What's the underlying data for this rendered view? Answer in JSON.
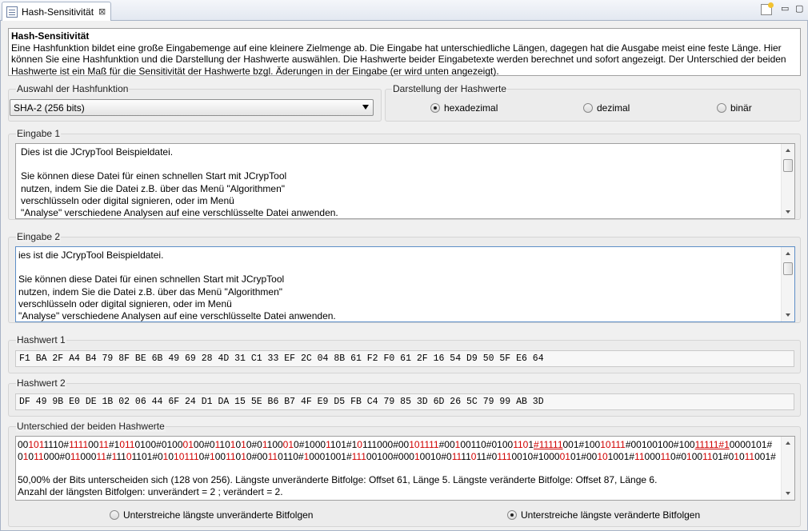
{
  "tab": {
    "title": "Hash-Sensitivität",
    "close": "⊠"
  },
  "view_controls": {
    "minimize": "▭",
    "maximize": "▢"
  },
  "description": {
    "title": "Hash-Sensitivität",
    "text": "Eine Hashfunktion bildet eine große Eingabemenge auf eine kleinere Zielmenge ab. Die Eingabe hat unterschiedliche Längen, dagegen hat die Ausgabe meist eine feste Länge. Hier können Sie eine Hashfunktion und die Darstellung der Hashwerte auswählen. Die Hashwerte beider Eingabetexte werden berechnet und sofort angezeigt. Der Unterschied der beiden Hashwerte ist ein Maß für die Sensitivität der Hashwerte bzgl. Äderungen in der Eingabe (er wird unten angezeigt)."
  },
  "hash_function": {
    "legend": "Auswahl der Hashfunktion",
    "selected": "SHA-2 (256 bits)"
  },
  "representation": {
    "legend": "Darstellung der Hashwerte",
    "options": [
      {
        "label": "hexadezimal",
        "selected": true
      },
      {
        "label": "dezimal",
        "selected": false
      },
      {
        "label": "binär",
        "selected": false
      }
    ]
  },
  "input1": {
    "legend": "Eingabe 1",
    "text": "Dies ist die JCrypTool Beispieldatei.\n\nSie können diese Datei für einen schnellen Start mit JCrypTool\nnutzen, indem Sie die Datei z.B. über das Menü \"Algorithmen\"\nverschlüsseln oder digital signieren, oder im Menü\n\"Analyse\" verschiedene Analysen auf eine verschlüsselte Datei anwenden."
  },
  "input2": {
    "legend": "Eingabe 2",
    "text": "ies ist die JCrypTool Beispieldatei.\n\nSie können diese Datei für einen schnellen Start mit JCrypTool\nnutzen, indem Sie die Datei z.B. über das Menü \"Algorithmen\"\nverschlüsseln oder digital signieren, oder im Menü\n\"Analyse\" verschiedene Analysen auf eine verschlüsselte Datei anwenden."
  },
  "hash1": {
    "legend": "Hashwert 1",
    "value": "F1 BA 2F A4 B4 79 8F BE 6B 49 69 28 4D 31 C1 33 EF 2C 04 8B 61 F2 F0 61 2F 16 54 D9 50 5F E6 64"
  },
  "hash2": {
    "legend": "Hashwert 2",
    "value": "DF 49 9B E0 DE 1B 02 06 44 6F 24 D1 DA 15 5E B6 B7 4F E9 D5 FB C4 79 85 3D 6D 26 5C 79 99 AB 3D"
  },
  "difference": {
    "legend": "Unterschied der beiden Hashwerte",
    "colors": {
      "changed": "#d00000"
    },
    "line1_segments": [
      {
        "t": "00"
      },
      {
        "t": "101",
        "c": 1
      },
      {
        "t": "1110#"
      },
      {
        "t": "1111",
        "c": 1
      },
      {
        "t": "00"
      },
      {
        "t": "11",
        "c": 1
      },
      {
        "t": "#1"
      },
      {
        "t": "011",
        "c": 1
      },
      {
        "t": "0100#0100"
      },
      {
        "t": "01",
        "c": 1
      },
      {
        "t": "00#0"
      },
      {
        "t": "1",
        "c": 1
      },
      {
        "t": "10"
      },
      {
        "t": "1",
        "c": 1
      },
      {
        "t": "0"
      },
      {
        "t": "1",
        "c": 1
      },
      {
        "t": "0#0"
      },
      {
        "t": "1",
        "c": 1
      },
      {
        "t": "100"
      },
      {
        "t": "01",
        "c": 1
      },
      {
        "t": "0#1000"
      },
      {
        "t": "1",
        "c": 1
      },
      {
        "t": "101#1"
      },
      {
        "t": "0",
        "c": 1
      },
      {
        "t": "111000#00"
      },
      {
        "t": "101111",
        "c": 1
      },
      {
        "t": "#00"
      },
      {
        "t": "1",
        "c": 1
      },
      {
        "t": "00110#0100"
      },
      {
        "t": "110",
        "c": 1
      },
      {
        "t": "1"
      },
      {
        "t": "#11111",
        "c": 1,
        "u": 1
      },
      {
        "t": "001#100"
      },
      {
        "t": "10",
        "c": 1
      },
      {
        "t": "111",
        "c": 1
      },
      {
        "t": "#00100100#100"
      },
      {
        "t": "11111#1",
        "c": 1,
        "u": 1
      },
      {
        "t": "0000101#"
      }
    ],
    "line2_segments": [
      {
        "t": "0"
      },
      {
        "t": "1",
        "c": 1
      },
      {
        "t": "0"
      },
      {
        "t": "11",
        "c": 1
      },
      {
        "t": "000#0"
      },
      {
        "t": "11",
        "c": 1
      },
      {
        "t": "000"
      },
      {
        "t": "11",
        "c": 1
      },
      {
        "t": "#"
      },
      {
        "t": "1",
        "c": 1
      },
      {
        "t": "11"
      },
      {
        "t": "0",
        "c": 1
      },
      {
        "t": "1101#0"
      },
      {
        "t": "1",
        "c": 1
      },
      {
        "t": "0"
      },
      {
        "t": "1",
        "c": 1
      },
      {
        "t": "0111",
        "c": 1
      },
      {
        "t": "0#"
      },
      {
        "t": "1",
        "c": 1
      },
      {
        "t": "00"
      },
      {
        "t": "11",
        "c": 1
      },
      {
        "t": "0"
      },
      {
        "t": "1",
        "c": 1
      },
      {
        "t": "0#00"
      },
      {
        "t": "11",
        "c": 1
      },
      {
        "t": "0110#"
      },
      {
        "t": "1",
        "c": 1
      },
      {
        "t": "0001001#"
      },
      {
        "t": "111",
        "c": 1
      },
      {
        "t": "00100#000"
      },
      {
        "t": "1",
        "c": 1
      },
      {
        "t": "0010#0"
      },
      {
        "t": "11",
        "c": 1
      },
      {
        "t": "11"
      },
      {
        "t": "0",
        "c": 1
      },
      {
        "t": "11#0"
      },
      {
        "t": "111",
        "c": 1
      },
      {
        "t": "0010#1000"
      },
      {
        "t": "01",
        "c": 1
      },
      {
        "t": "01#00"
      },
      {
        "t": "10",
        "c": 1
      },
      {
        "t": "1001#"
      },
      {
        "t": "11",
        "c": 1
      },
      {
        "t": "000"
      },
      {
        "t": "11",
        "c": 1
      },
      {
        "t": "0#0"
      },
      {
        "t": "1",
        "c": 1
      },
      {
        "t": "00"
      },
      {
        "t": "11",
        "c": 1
      },
      {
        "t": "01#0"
      },
      {
        "t": "1",
        "c": 1
      },
      {
        "t": "0"
      },
      {
        "t": "11",
        "c": 1
      },
      {
        "t": "001#"
      }
    ],
    "summary1": "50,00% der Bits unterscheiden sich (128 von 256). Längste unveränderte Bitfolge: Offset 61, Länge 5. Längste veränderte Bitfolge: Offset 87, Länge 6.",
    "summary2": "Anzahl der längsten Bitfolgen: unverändert = 2 ; verändert = 2."
  },
  "underline_options": [
    {
      "label": "Unterstreiche längste unveränderte Bitfolgen",
      "selected": false
    },
    {
      "label": "Unterstreiche längste veränderte Bitfolgen",
      "selected": true
    }
  ]
}
